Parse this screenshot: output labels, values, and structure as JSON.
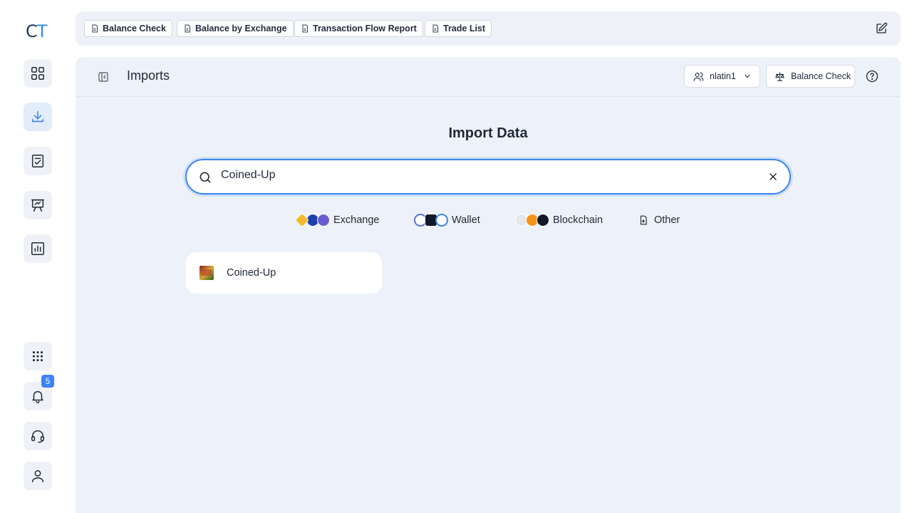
{
  "logo": {
    "c": "C",
    "t": "T"
  },
  "rail": {
    "notification_count": "5"
  },
  "tabs": [
    {
      "label": "Balance Check"
    },
    {
      "label": "Balance by Exchange"
    },
    {
      "label": "Transaction Flow Report"
    },
    {
      "label": "Trade List"
    }
  ],
  "header": {
    "title": "Imports",
    "user": "nlatin1",
    "balance_button": "Balance Check"
  },
  "main": {
    "title": "Import Data",
    "search_value": "Coined-Up",
    "filters": [
      {
        "label": "Exchange"
      },
      {
        "label": "Wallet"
      },
      {
        "label": "Blockchain"
      },
      {
        "label": "Other"
      }
    ],
    "results": [
      {
        "name": "Coined-Up"
      }
    ]
  },
  "colors": {
    "accent": "#3b82f6",
    "panel_bg": "#edf2fa",
    "logo_c": "#1e3a5f",
    "logo_t": "#2f8ff0"
  }
}
